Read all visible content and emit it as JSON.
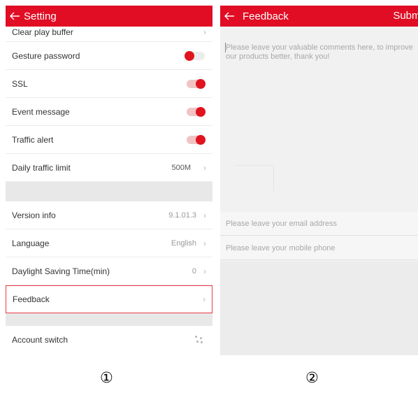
{
  "screen1": {
    "title": "Setting",
    "rows": {
      "clear_play_buffer": "Clear play buffer",
      "gesture_password": "Gesture password",
      "ssl": "SSL",
      "event_message": "Event message",
      "traffic_alert": "Traffic alert",
      "daily_traffic_limit": "Daily traffic limit",
      "daily_traffic_value": "500M",
      "version_info": "Version info",
      "version_value": "9.1.01.3",
      "language": "Language",
      "language_value": "English",
      "dst": "Daylight Saving Time(min)",
      "dst_value": "0",
      "feedback": "Feedback",
      "account_switch": "Account switch"
    },
    "toggles": {
      "gesture_password": false,
      "ssl": true,
      "event_message": true,
      "traffic_alert": true
    },
    "chevron": "›"
  },
  "screen2": {
    "title": "Feedback",
    "submit": "Submit",
    "comment_placeholder": "Please leave your valuable comments here, to improve our products better, thank you!",
    "email_placeholder": "Please leave your email address",
    "phone_placeholder": "Please leave your mobile phone"
  },
  "captions": [
    "①",
    "②"
  ],
  "colors": {
    "accent": "#e00d24",
    "highlight": "#e83a43"
  }
}
